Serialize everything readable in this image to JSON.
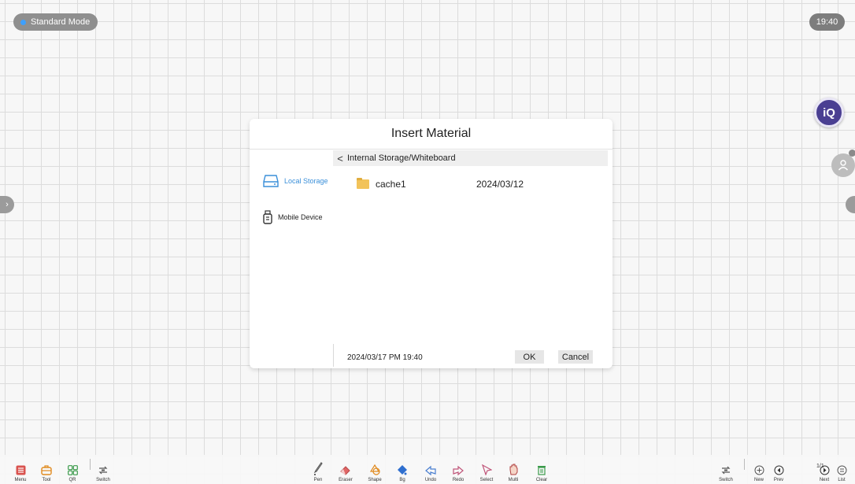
{
  "top_bar": {
    "mode_label": "Standard Mode",
    "clock": "19:40"
  },
  "floating": {
    "iq_label": "iQ"
  },
  "dialog": {
    "title": "Insert Material",
    "path": "Internal Storage/Whiteboard",
    "nav": [
      {
        "label": "Local Storage",
        "icon": "hard-drive-icon",
        "selected": true
      },
      {
        "label": "Mobile Device",
        "icon": "usb-drive-icon",
        "selected": false
      }
    ],
    "files": [
      {
        "name": "cache1",
        "date": "2024/03/12",
        "icon": "folder-icon"
      }
    ],
    "footer_datetime": "2024/03/17 PM 19:40",
    "ok_label": "OK",
    "cancel_label": "Cancel"
  },
  "toolbar": {
    "left": [
      {
        "label": "Menu",
        "icon": "menu-icon"
      },
      {
        "label": "Tool",
        "icon": "toolbox-icon"
      },
      {
        "label": "QR",
        "icon": "qr-grid-icon"
      },
      {
        "label": "Switch",
        "icon": "switch-icon"
      }
    ],
    "center": [
      {
        "label": "Pen",
        "icon": "pen-icon"
      },
      {
        "label": "Eraser",
        "icon": "eraser-icon"
      },
      {
        "label": "Shape",
        "icon": "shape-icon"
      },
      {
        "label": "Bg",
        "icon": "bg-fill-icon"
      },
      {
        "label": "Undo",
        "icon": "undo-icon"
      },
      {
        "label": "Redo",
        "icon": "redo-icon"
      },
      {
        "label": "Select",
        "icon": "select-cursor-icon"
      },
      {
        "label": "Multi",
        "icon": "multi-touch-icon"
      },
      {
        "label": "Clear",
        "icon": "trash-icon"
      }
    ],
    "right": [
      {
        "label": "Switch",
        "icon": "switch-icon"
      },
      {
        "label": "New",
        "icon": "plus-circle-icon"
      },
      {
        "label": "Prev",
        "icon": "prev-circle-icon"
      },
      {
        "label": "Next",
        "icon": "next-circle-icon"
      },
      {
        "label": "List",
        "icon": "list-circle-icon"
      }
    ],
    "page_count": "1/1"
  },
  "colors": {
    "accent": "#3a8fd9",
    "iq_purple": "#4a3f92",
    "folder": "#f2c35a",
    "menu_red": "#d9534f"
  }
}
